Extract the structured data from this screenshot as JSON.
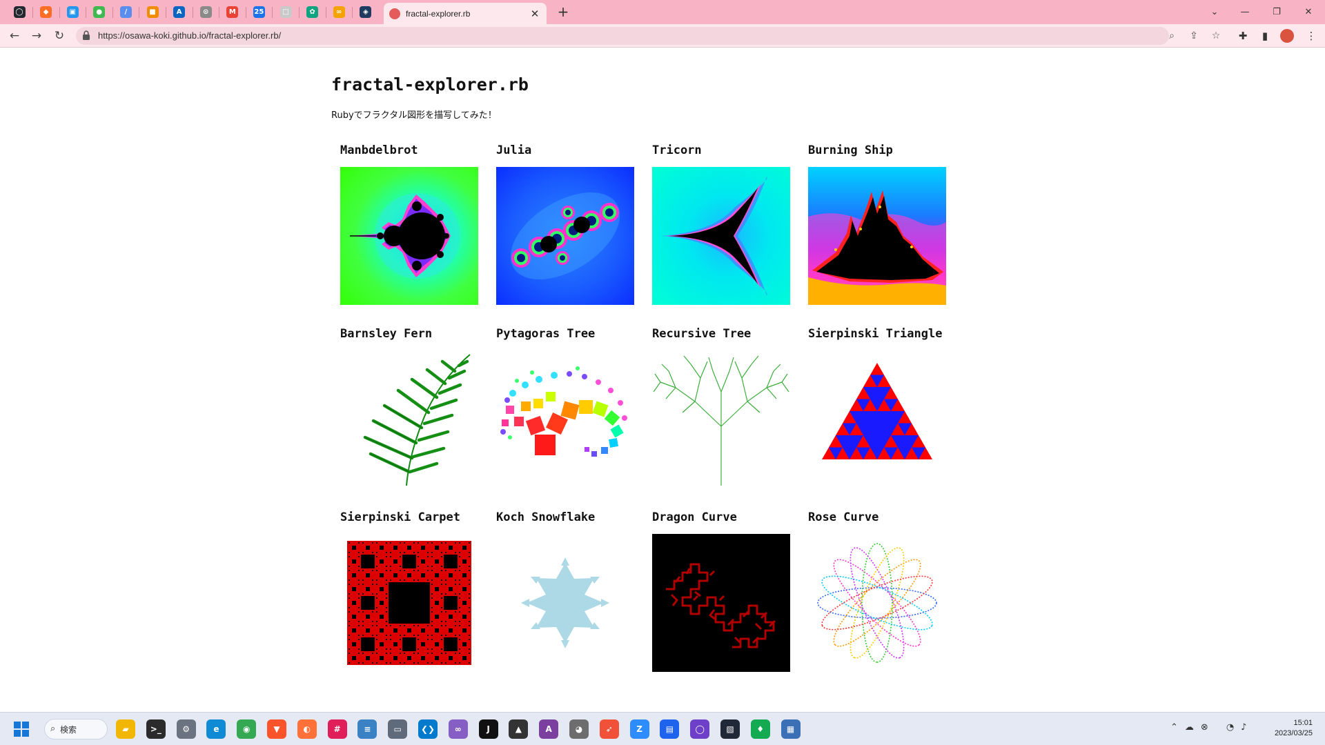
{
  "browser": {
    "active_tab_title": "fractal-explorer.rb",
    "url": "https://osawa-koki.github.io/fractal-explorer.rb/",
    "pinned_tabs": [
      {
        "icon": "github-icon",
        "color": "#24292f",
        "glyph": "◯"
      },
      {
        "icon": "gitlab-icon",
        "color": "#fc6d26",
        "glyph": "◆"
      },
      {
        "icon": "docker-icon",
        "color": "#2496ed",
        "glyph": "▣"
      },
      {
        "icon": "green-app-icon",
        "color": "#3fb950",
        "glyph": "●"
      },
      {
        "icon": "dev-tool-icon",
        "color": "#5a8dee",
        "glyph": "∕"
      },
      {
        "icon": "aws-box-icon",
        "color": "#f08c00",
        "glyph": "■"
      },
      {
        "icon": "azure-icon",
        "color": "#0a66c2",
        "glyph": "A"
      },
      {
        "icon": "settings-app-icon",
        "color": "#8a8a8a",
        "glyph": "⊙"
      },
      {
        "icon": "gmail-icon",
        "color": "#ea4335",
        "glyph": "M"
      },
      {
        "icon": "calendar-icon",
        "color": "#1a73e8",
        "glyph": "25"
      },
      {
        "icon": "blank-page-icon",
        "color": "#c9c9c9",
        "glyph": "□"
      },
      {
        "icon": "chatgpt-icon",
        "color": "#10a37f",
        "glyph": "✿"
      },
      {
        "icon": "link-icon",
        "color": "#f4a300",
        "glyph": "∞"
      },
      {
        "icon": "diamond-app-icon",
        "color": "#1e3a5f",
        "glyph": "◈"
      }
    ]
  },
  "page": {
    "title": "fractal-explorer.rb",
    "description": "Rubyでフラクタル図形を描写してみた！",
    "fractals": [
      {
        "id": "mandelbrot",
        "title": "Manbdelbrot"
      },
      {
        "id": "julia",
        "title": "Julia"
      },
      {
        "id": "tricorn",
        "title": "Tricorn"
      },
      {
        "id": "burning-ship",
        "title": "Burning Ship"
      },
      {
        "id": "barnsley-fern",
        "title": "Barnsley Fern"
      },
      {
        "id": "pythagoras-tree",
        "title": "Pytagoras Tree"
      },
      {
        "id": "recursive-tree",
        "title": "Recursive Tree"
      },
      {
        "id": "sierpinski-triangle",
        "title": "Sierpinski Triangle"
      },
      {
        "id": "sierpinski-carpet",
        "title": "Sierpinski Carpet"
      },
      {
        "id": "koch-snowflake",
        "title": "Koch Snowflake"
      },
      {
        "id": "dragon-curve",
        "title": "Dragon Curve"
      },
      {
        "id": "rose-curve",
        "title": "Rose Curve"
      }
    ]
  },
  "taskbar": {
    "search_label": "検索",
    "apps": [
      {
        "icon": "file-explorer-icon",
        "color": "#f2b705",
        "glyph": "▰"
      },
      {
        "icon": "terminal-icon",
        "color": "#2b2b2b",
        "glyph": ">_"
      },
      {
        "icon": "settings-icon",
        "color": "#6b7280",
        "glyph": "⚙"
      },
      {
        "icon": "edge-icon",
        "color": "#0f8bd6",
        "glyph": "e"
      },
      {
        "icon": "chrome-icon",
        "color": "#34a853",
        "glyph": "◉"
      },
      {
        "icon": "brave-icon",
        "color": "#fb542b",
        "glyph": "▼"
      },
      {
        "icon": "firefox-icon",
        "color": "#ff7139",
        "glyph": "◐"
      },
      {
        "icon": "slack-icon",
        "color": "#e01e5a",
        "glyph": "#"
      },
      {
        "icon": "notepad-icon",
        "color": "#3b82c4",
        "glyph": "≡"
      },
      {
        "icon": "remote-desktop-icon",
        "color": "#5f6b7a",
        "glyph": "▭"
      },
      {
        "icon": "vscode-icon",
        "color": "#007acc",
        "glyph": "❮❯"
      },
      {
        "icon": "visual-studio-icon",
        "color": "#865fc5",
        "glyph": "∞"
      },
      {
        "icon": "jetbrains-icon",
        "color": "#111111",
        "glyph": "J"
      },
      {
        "icon": "inkscape-icon",
        "color": "#333333",
        "glyph": "▲"
      },
      {
        "icon": "affinity-icon",
        "color": "#7b3fa0",
        "glyph": "A"
      },
      {
        "icon": "gimp-icon",
        "color": "#6d6d6d",
        "glyph": "◕"
      },
      {
        "icon": "swift-icon",
        "color": "#f05138",
        "glyph": "➶"
      },
      {
        "icon": "zoom-icon",
        "color": "#2d8cff",
        "glyph": "Z"
      },
      {
        "icon": "docker-desktop-icon",
        "color": "#1d63ed",
        "glyph": "▤"
      },
      {
        "icon": "github-desktop-icon",
        "color": "#6e40c9",
        "glyph": "◯"
      },
      {
        "icon": "package-app-icon",
        "color": "#1f2937",
        "glyph": "▧"
      },
      {
        "icon": "mongodb-icon",
        "color": "#13aa52",
        "glyph": "♦"
      },
      {
        "icon": "tiles-app-icon",
        "color": "#3b6fb6",
        "glyph": "▦"
      }
    ],
    "time": "15:01",
    "date": "2023/03/25"
  }
}
